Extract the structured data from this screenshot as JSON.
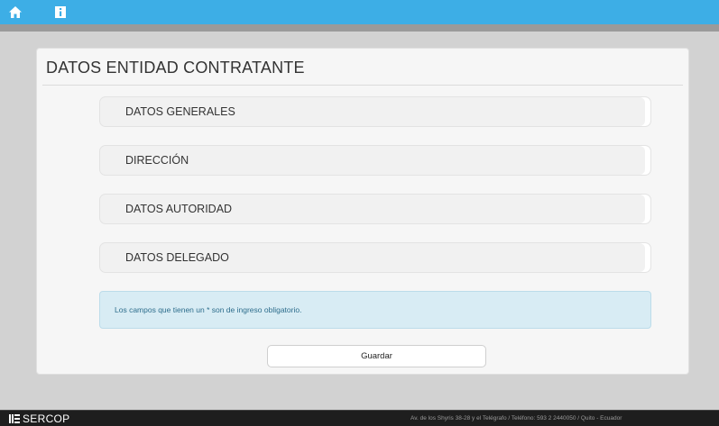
{
  "header": {
    "home_icon": "home-icon",
    "info_icon": "info-icon",
    "color": "#3daee6"
  },
  "panel": {
    "title": "DATOS ENTIDAD CONTRATANTE",
    "sections": [
      {
        "label": "DATOS GENERALES"
      },
      {
        "label": "DIRECCIÓN"
      },
      {
        "label": "DATOS AUTORIDAD"
      },
      {
        "label": "DATOS DELEGADO"
      }
    ],
    "notice": "Los campos que tienen un * son de ingreso obligatorio.",
    "save_label": "Guardar"
  },
  "footer": {
    "logo_text": "SERCOP",
    "address": "Av. de los Shyris 38-28 y el Telégrafo / Teléfono: 593 2 2440050 / Quito - Ecuador"
  },
  "colors": {
    "notice_bg": "#d8ecf4",
    "notice_text": "#2d6d8c",
    "footer_bg": "#1e1e1e"
  }
}
